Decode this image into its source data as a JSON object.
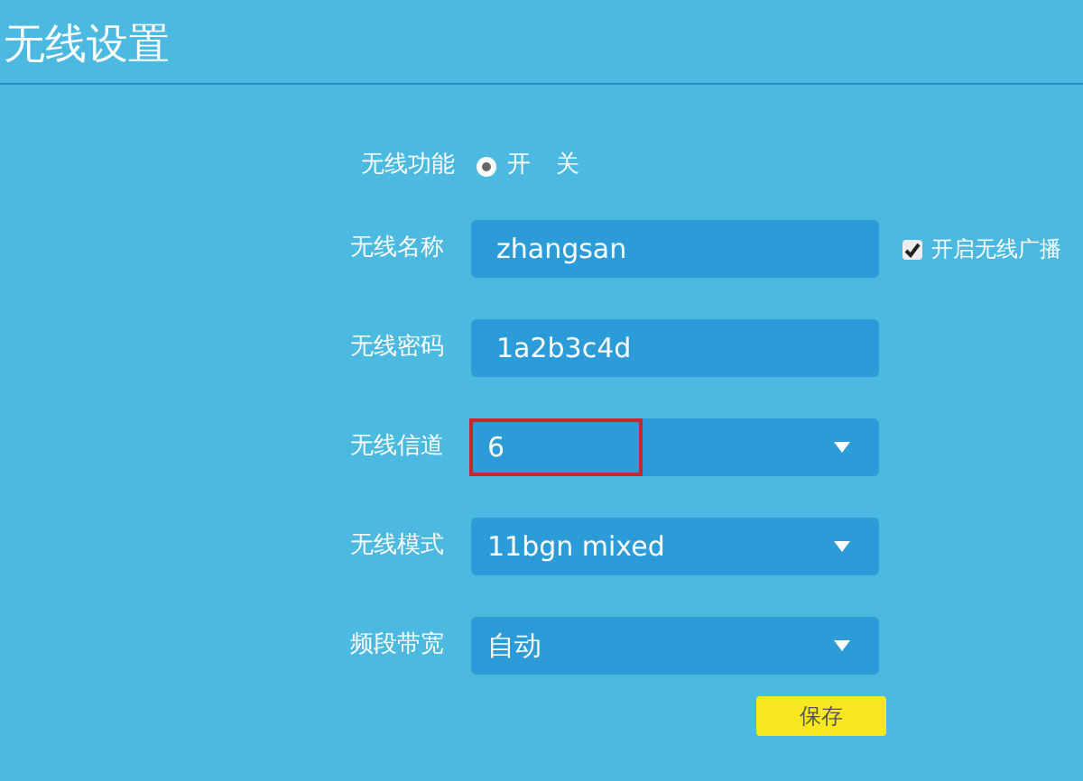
{
  "title": "无线设置",
  "wireless_switch": {
    "label": "无线功能",
    "options": [
      {
        "label": "开",
        "selected": true
      },
      {
        "label": "关",
        "selected": false
      }
    ]
  },
  "fields": [
    {
      "kind": "text",
      "label": "无线名称",
      "value": "zhangsan",
      "highlighted": false,
      "extra_checkbox": {
        "label": "开启无线广播",
        "checked": true
      }
    },
    {
      "kind": "text",
      "label": "无线密码",
      "value": "1a2b3c4d",
      "highlighted": false
    },
    {
      "kind": "select",
      "label": "无线信道",
      "value": "6",
      "highlighted": true
    },
    {
      "kind": "select",
      "label": "无线模式",
      "value": "11bgn mixed",
      "highlighted": false
    },
    {
      "kind": "select",
      "label": "频段带宽",
      "value": "自动",
      "highlighted": false
    }
  ],
  "save_button": "保存"
}
